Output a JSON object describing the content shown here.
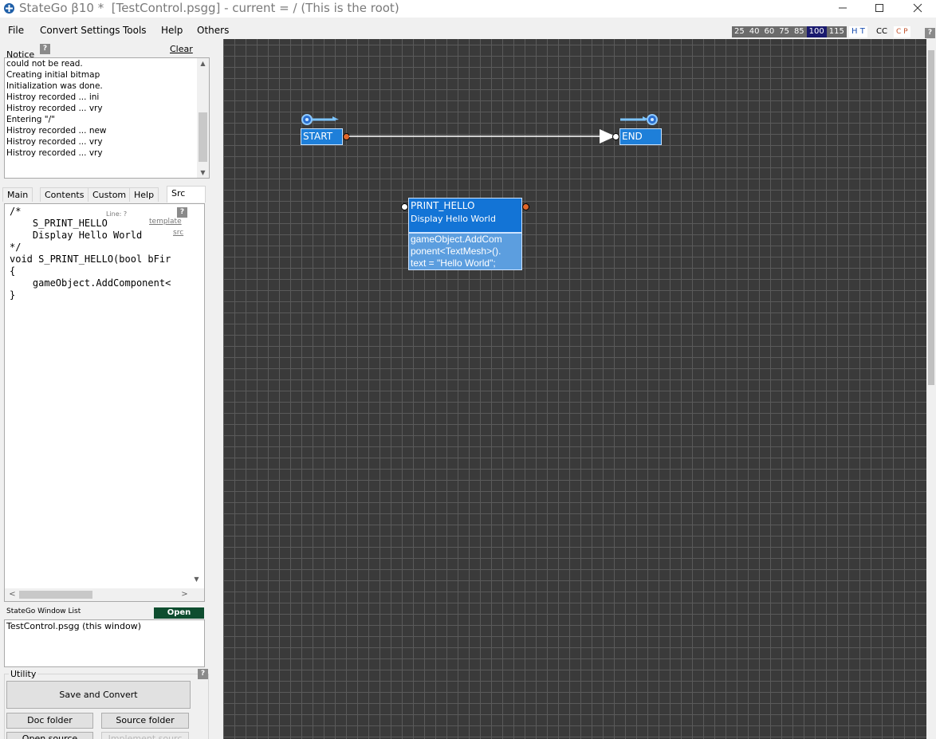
{
  "window": {
    "title": "StateGo β10 *  [TestControl.psgg] - current = / (This is the root)"
  },
  "menu": [
    "File",
    "Convert Settings",
    "Tools",
    "Help",
    "Others"
  ],
  "zoom": {
    "levels": [
      "25",
      "40",
      "60",
      "75",
      "85",
      "100",
      "115"
    ],
    "selected": "100",
    "ht_label": "H T",
    "cc_label": "CC",
    "cp_label": "C P",
    "help": "?"
  },
  "notice": {
    "label": "Notice",
    "help": "?",
    "clear_label": "Clear",
    "lines": [
      "could not be read.",
      "Creating initial bitmap",
      "Initialization was done.",
      "Histroy recorded ... ini",
      "Histroy recorded ... vry",
      "Entering \"/\"",
      "Histroy recorded ... new",
      "Histroy recorded ... vry",
      "Histroy recorded ... vry"
    ]
  },
  "tabs": [
    "Main",
    "Contents",
    "Custom",
    "Help",
    "Src"
  ],
  "active_tab": "Src",
  "src": {
    "line_info": "Line: ?",
    "help": "?",
    "template_link": "template",
    "src_link": "src",
    "code_lines": [
      "/*",
      "    S_PRINT_HELLO",
      "    Display Hello World",
      "*/",
      "void S_PRINT_HELLO(bool bFir",
      "{",
      "    gameObject.AddComponent<",
      "}"
    ]
  },
  "window_list": {
    "label": "StateGo Window List",
    "open_label": "Open",
    "items": [
      "TestControl.psgg (this window)"
    ]
  },
  "utility": {
    "label": "Utility",
    "help": "?",
    "save_convert": "Save and Convert",
    "doc_folder": "Doc folder",
    "source_folder": "Source folder",
    "open_source": "Open source",
    "implement_source": "Implement sourc"
  },
  "canvas": {
    "start_state": {
      "name": "START"
    },
    "end_state": {
      "name": "END"
    },
    "print_state": {
      "name": "PRINT_HELLO",
      "comment": "Display Hello World",
      "code": [
        "gameObject.AddCom",
        "ponent<TextMesh>().",
        "text = \"Hello World\";"
      ]
    }
  },
  "colors": {
    "canvas_bg": "#3a3a3a",
    "state_blue": "#1e7fd9",
    "code_blue": "#5c9edf",
    "port_orange": "#e0662a",
    "open_button": "#0e4d2f",
    "zoom_selected": "#1a1a6e"
  }
}
